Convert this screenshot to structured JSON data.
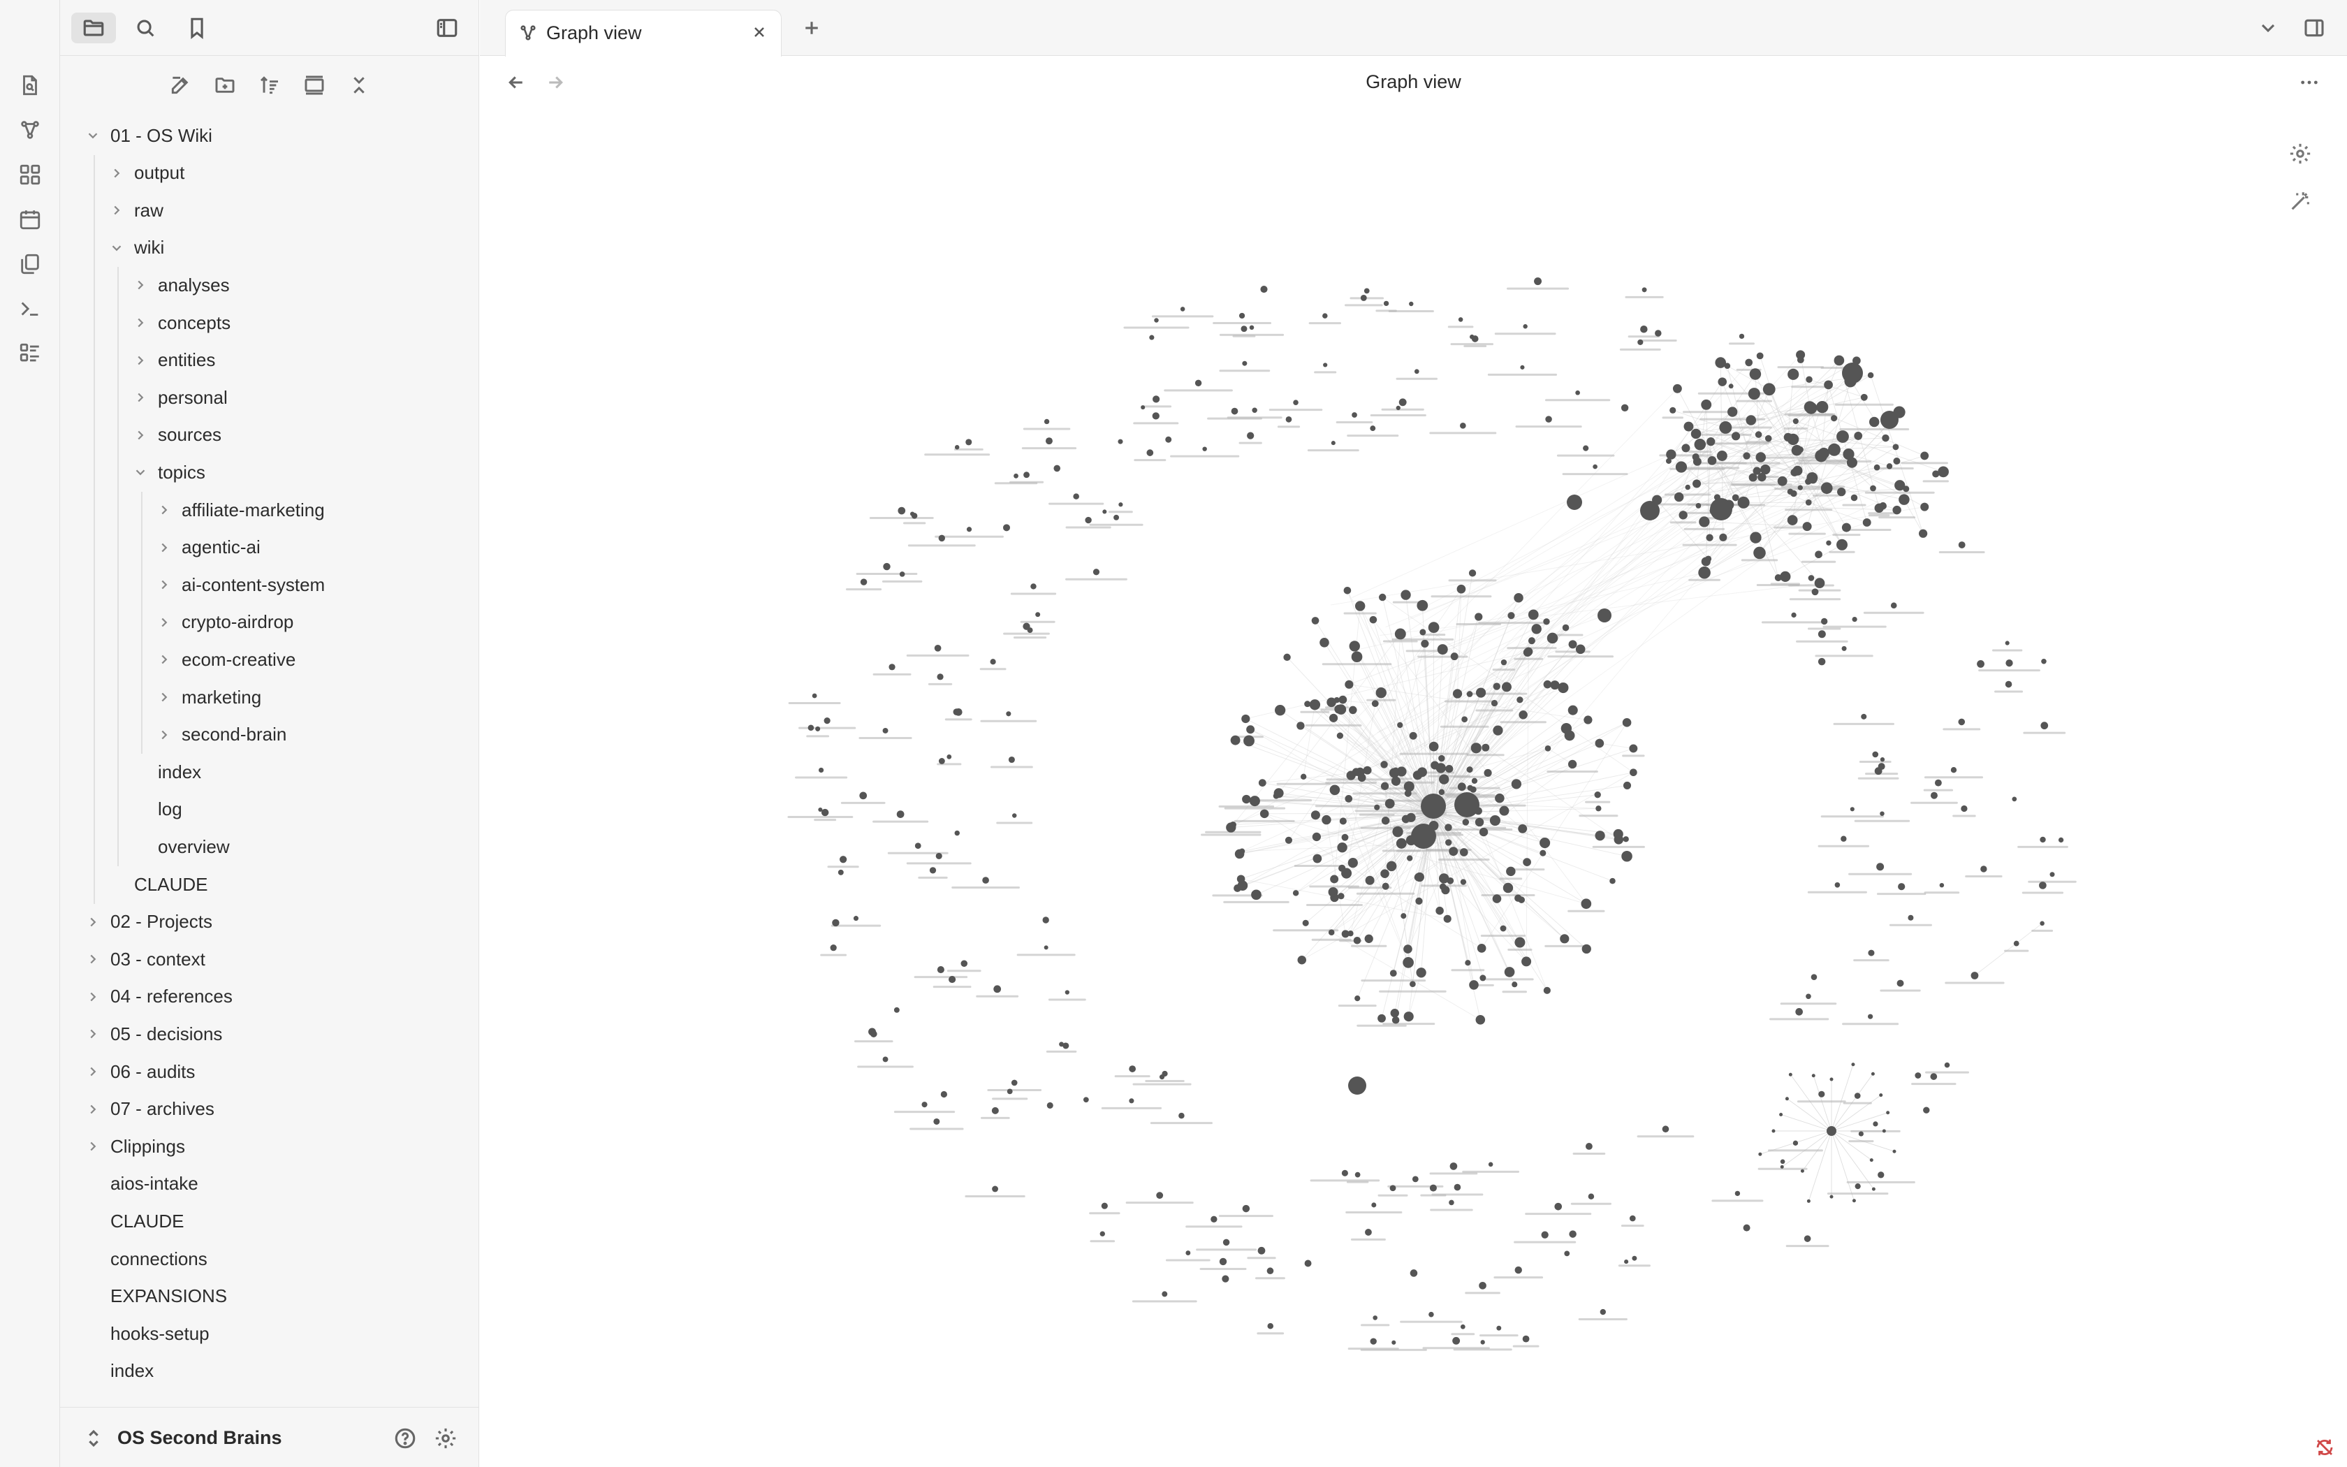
{
  "tab": {
    "title": "Graph view"
  },
  "view": {
    "title": "Graph view"
  },
  "vault": {
    "name": "OS Second Brains"
  },
  "ribbon": {
    "icons": [
      "open-quick-switcher-icon",
      "graph-icon",
      "canvas-icon",
      "daily-note-icon",
      "templates-icon",
      "terminal-icon",
      "bases-icon"
    ]
  },
  "tree": [
    {
      "label": "01 - OS Wiki",
      "depth": 0,
      "expanded": true,
      "folder": true
    },
    {
      "label": "output",
      "depth": 1,
      "expanded": false,
      "folder": true
    },
    {
      "label": "raw",
      "depth": 1,
      "expanded": false,
      "folder": true
    },
    {
      "label": "wiki",
      "depth": 1,
      "expanded": true,
      "folder": true
    },
    {
      "label": "analyses",
      "depth": 2,
      "expanded": false,
      "folder": true
    },
    {
      "label": "concepts",
      "depth": 2,
      "expanded": false,
      "folder": true
    },
    {
      "label": "entities",
      "depth": 2,
      "expanded": false,
      "folder": true
    },
    {
      "label": "personal",
      "depth": 2,
      "expanded": false,
      "folder": true
    },
    {
      "label": "sources",
      "depth": 2,
      "expanded": false,
      "folder": true
    },
    {
      "label": "topics",
      "depth": 2,
      "expanded": true,
      "folder": true
    },
    {
      "label": "affiliate-marketing",
      "depth": 3,
      "expanded": false,
      "folder": true
    },
    {
      "label": "agentic-ai",
      "depth": 3,
      "expanded": false,
      "folder": true
    },
    {
      "label": "ai-content-system",
      "depth": 3,
      "expanded": false,
      "folder": true
    },
    {
      "label": "crypto-airdrop",
      "depth": 3,
      "expanded": false,
      "folder": true
    },
    {
      "label": "ecom-creative",
      "depth": 3,
      "expanded": false,
      "folder": true
    },
    {
      "label": "marketing",
      "depth": 3,
      "expanded": false,
      "folder": true
    },
    {
      "label": "second-brain",
      "depth": 3,
      "expanded": false,
      "folder": true
    },
    {
      "label": "index",
      "depth": 2,
      "folder": false
    },
    {
      "label": "log",
      "depth": 2,
      "folder": false
    },
    {
      "label": "overview",
      "depth": 2,
      "folder": false
    },
    {
      "label": "CLAUDE",
      "depth": 1,
      "folder": false
    },
    {
      "label": "02 - Projects",
      "depth": 0,
      "expanded": false,
      "folder": true
    },
    {
      "label": "03 - context",
      "depth": 0,
      "expanded": false,
      "folder": true
    },
    {
      "label": "04 - references",
      "depth": 0,
      "expanded": false,
      "folder": true
    },
    {
      "label": "05 - decisions",
      "depth": 0,
      "expanded": false,
      "folder": true
    },
    {
      "label": "06 - audits",
      "depth": 0,
      "expanded": false,
      "folder": true
    },
    {
      "label": "07 - archives",
      "depth": 0,
      "expanded": false,
      "folder": true
    },
    {
      "label": "Clippings",
      "depth": 0,
      "expanded": false,
      "folder": true
    },
    {
      "label": "aios-intake",
      "depth": 0,
      "folder": false
    },
    {
      "label": "CLAUDE",
      "depth": 0,
      "folder": false
    },
    {
      "label": "connections",
      "depth": 0,
      "folder": false
    },
    {
      "label": "EXPANSIONS",
      "depth": 0,
      "folder": false
    },
    {
      "label": "hooks-setup",
      "depth": 0,
      "folder": false
    },
    {
      "label": "index",
      "depth": 0,
      "folder": false
    }
  ],
  "graph": {
    "node_color": "#555555",
    "edge_color": "#cfcfcf",
    "label_color": "#b0b0b0"
  }
}
